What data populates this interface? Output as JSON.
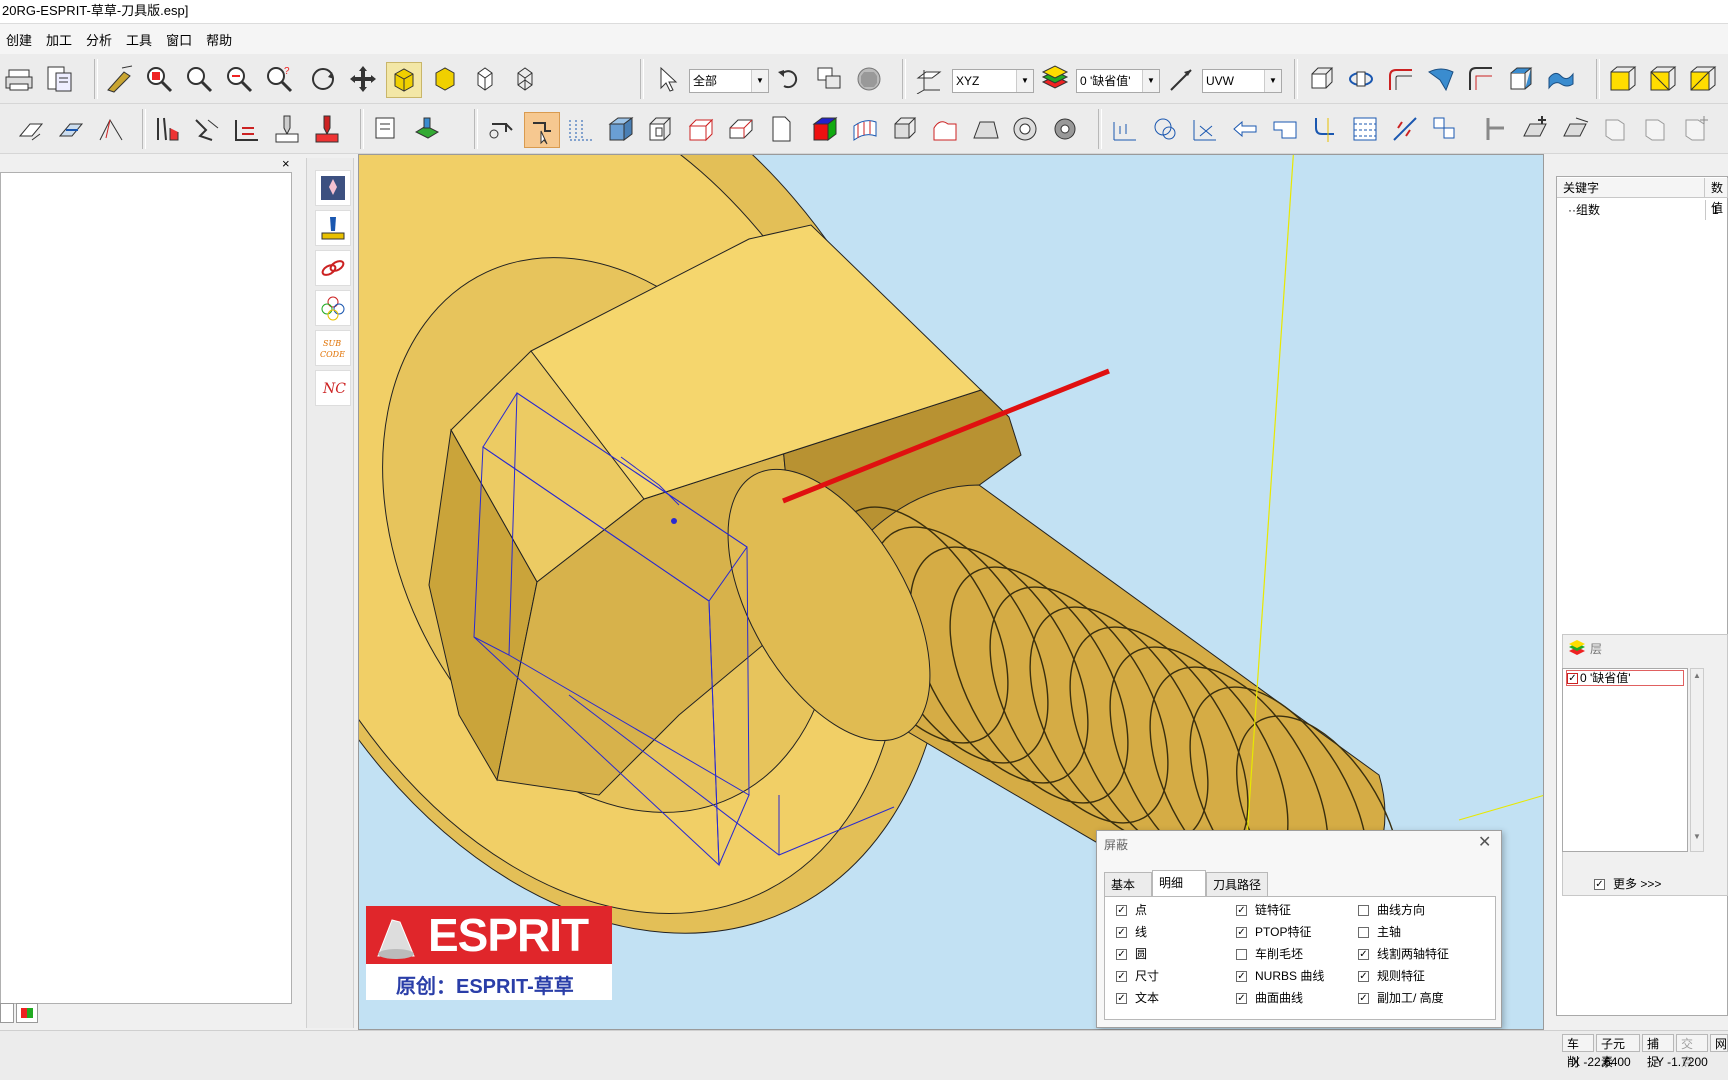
{
  "window": {
    "title": "20RG-ESPRIT-草草-刀具版.esp]"
  },
  "menu": [
    "创建",
    "加工",
    "分析",
    "工具",
    "窗口",
    "帮助"
  ],
  "toolbar": {
    "filter_combo": "全部",
    "coord_combo": "XYZ",
    "layer_combo": "0 '缺省值'",
    "uvw_combo": "UVW"
  },
  "properties": {
    "col_key": "关键字",
    "col_value": "数值",
    "rows": [
      {
        "key": "组数",
        "value": "1"
      }
    ]
  },
  "layer_panel": {
    "title": "层",
    "layer_item": "0 '缺省值'",
    "more_label": "更多 >>>"
  },
  "logo": {
    "brand": "ESPRIT",
    "subtitle": "原创：ESPRIT-草草"
  },
  "dialog": {
    "title": "屏蔽",
    "tabs": [
      "基本",
      "明细",
      "刀具路径"
    ],
    "active_tab": "明细",
    "col1": [
      {
        "label": "点",
        "checked": true
      },
      {
        "label": "线",
        "checked": true
      },
      {
        "label": "圆",
        "checked": true
      },
      {
        "label": "尺寸",
        "checked": true
      },
      {
        "label": "文本",
        "checked": true
      }
    ],
    "col2": [
      {
        "label": "链特征",
        "checked": true
      },
      {
        "label": "PTOP特征",
        "checked": true
      },
      {
        "label": "车削毛坯",
        "checked": false
      },
      {
        "label": "NURBS 曲线",
        "checked": true
      },
      {
        "label": "曲面曲线",
        "checked": true
      }
    ],
    "col3": [
      {
        "label": "曲线方向",
        "checked": false
      },
      {
        "label": "主轴",
        "checked": false
      },
      {
        "label": "线割两轴特征",
        "checked": true
      },
      {
        "label": "规则特征",
        "checked": true
      },
      {
        "label": "副加工/ 高度",
        "checked": true
      }
    ]
  },
  "statusbar": {
    "modes": [
      {
        "label": "车削",
        "dim": false
      },
      {
        "label": "子元素",
        "dim": false
      },
      {
        "label": "捕捉",
        "dim": false
      },
      {
        "label": "交点",
        "dim": true
      },
      {
        "label": "网格",
        "dim": false
      }
    ],
    "x_coord": "X -22.6400",
    "y_coord": "Y -1.7200"
  },
  "colors": {
    "part_yellow": "#f3d46a",
    "selected_edge": "#e01010",
    "viewport_bg": "#c2e1f3",
    "logo_red": "#e0262b"
  }
}
